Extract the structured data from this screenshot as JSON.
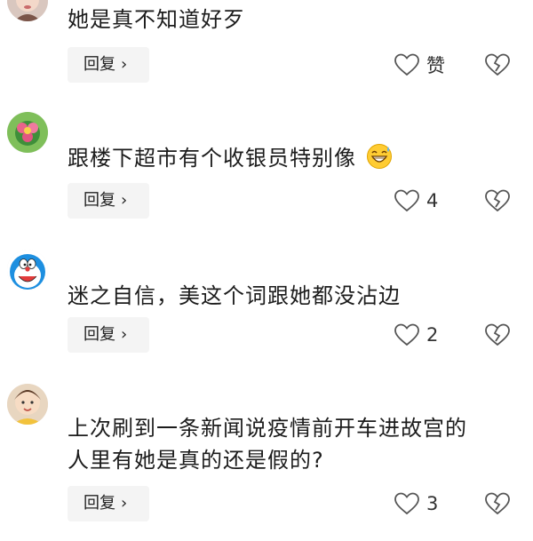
{
  "comments": [
    {
      "text": "她是真不知道好歹",
      "reply_label": "回复",
      "like_label": "赞",
      "avatar": "girl-portrait-avatar"
    },
    {
      "text": "跟楼下超市有个收银员特别像",
      "emoji": "grinning-sweat-emoji",
      "reply_label": "回复",
      "like_count": "4",
      "avatar": "green-flower-avatar"
    },
    {
      "text": "迷之自信，美这个词跟她都没沾边",
      "reply_label": "回复",
      "like_count": "2",
      "avatar": "doraemon-avatar"
    },
    {
      "text_line1": "上次刷到一条新闻说疫情前开车进故宫的",
      "text_line2": "人里有她是真的还是假的?",
      "reply_label": "回复",
      "like_count": "3",
      "avatar": "baby-avatar"
    }
  ],
  "icons": {
    "like": "heart-outline-icon",
    "dislike": "broken-heart-icon",
    "chevron": "chevron-right-icon"
  },
  "colors": {
    "button_bg": "#f4f4f4",
    "text": "#1c1c1c",
    "icon": "#555555"
  }
}
